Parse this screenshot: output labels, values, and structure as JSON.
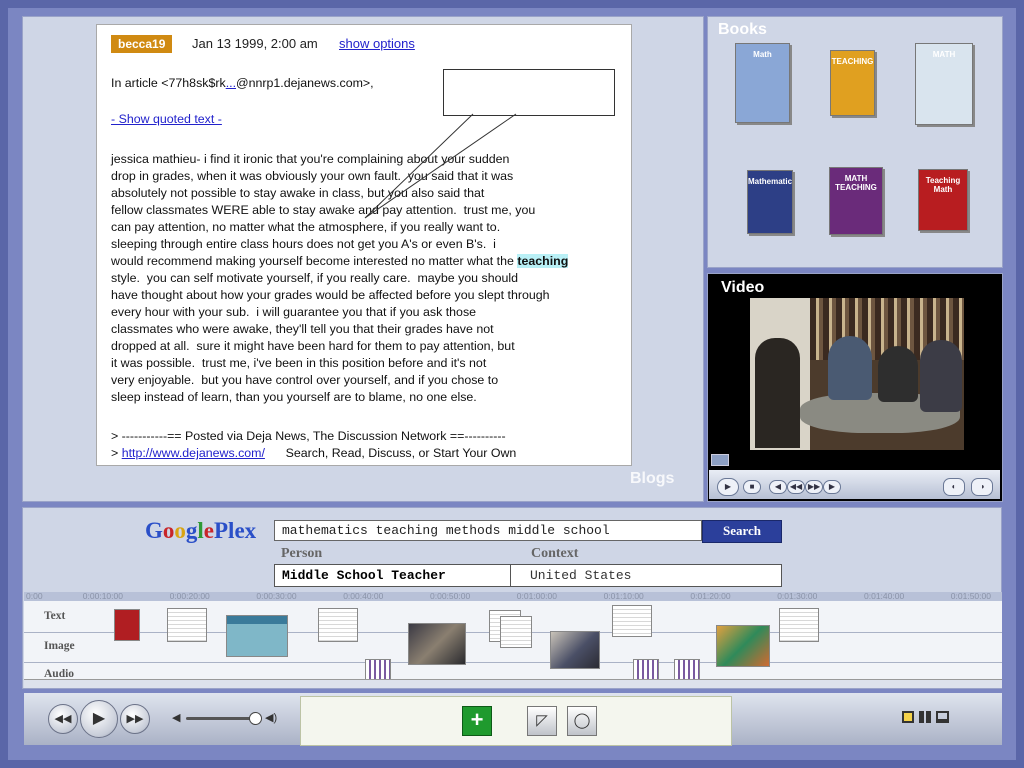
{
  "post": {
    "author": "becca19",
    "date": "Jan 13 1999, 2:00 am",
    "show_options": "show options",
    "article_line_pre": "In article <77h8sk$rk",
    "article_line_link": "...",
    "article_line_post": "@nnrp1.dejanews.com>,",
    "show_quoted": "- Show quoted text -",
    "body_before": "jessica mathieu- i find it ironic that you're complaining about your sudden\ndrop in grades, when it was obviously your own fault.  you said that it was\nabsolutely not possible to stay awake in class, but you also said that\nfellow classmates WERE able to stay awake and pay attention.  trust me, you\ncan pay attention, no matter what the atmosphere, if you really want to.\nsleeping through entire class hours does not get you A's or even B's.  i\nwould recommend making yourself become interested no matter what the ",
    "highlight": "teaching",
    "body_after": "\nstyle.  you can self motivate yourself, if you really care.  maybe you should\nhave thought about how your grades would be affected before you slept through\nevery hour with your sub.  i will guarantee you that if you ask those\nclassmates who were awake, they'll tell you that their grades have not\ndropped at all.  sure it might have been hard for them to pay attention, but\nit was possible.  trust me, i've been in this position before and it's not\nvery enjoyable.  but you have control over yourself, and if you chose to\nsleep instead of learn, than you yourself are to blame, no one else.",
    "footer1": "> -----------== Posted via Deja News, The Discussion Network ==----------",
    "footer2_prefix": "> ",
    "footer2_link": "http://www.dejanews.com/",
    "footer2_suffix": "      Search, Read, Discuss, or Start Your Own"
  },
  "panes": {
    "blogs": "Blogs",
    "books": "Books",
    "video": "Video"
  },
  "books": [
    {
      "label": "Math",
      "color": "#8aa7d6"
    },
    {
      "label": "TEACHING",
      "color": "#e0a020"
    },
    {
      "label": "MATH",
      "color": "#d9e4ee"
    },
    {
      "label": "Mathematics",
      "color": "#2d3f86"
    },
    {
      "label": "MATH TEACHING",
      "color": "#6a2b7a"
    },
    {
      "label": "Teaching Math",
      "color": "#b81d20"
    }
  ],
  "search": {
    "logo_parts": [
      "G",
      "o",
      "o",
      "g",
      "l",
      "e",
      "Plex"
    ],
    "logo_colors": [
      "#2a4fc8",
      "#c8262a",
      "#d9a412",
      "#2a4fc8",
      "#2f9a36",
      "#c8262a",
      "#2a4fc8"
    ],
    "query": "mathematics teaching methods middle school",
    "button": "Search",
    "person_label": "Person",
    "context_label": "Context",
    "person_value": "Middle School Teacher",
    "context_value": "United States"
  },
  "timeline": {
    "ticks": [
      "0:00",
      "0:00:10:00",
      "0:00:20:00",
      "0:00:30:00",
      "0:00:40:00",
      "0:00:50:00",
      "0:01:00:00",
      "0:01:10:00",
      "0:01:20:00",
      "0:01:30:00",
      "0:01:40:00",
      "0:01:50:00"
    ],
    "tracks": [
      "Text",
      "Image",
      "Audio"
    ]
  },
  "colors": {
    "accent": "#2b3f9b",
    "badge": "#d08a12",
    "add": "#1f9a2e"
  }
}
